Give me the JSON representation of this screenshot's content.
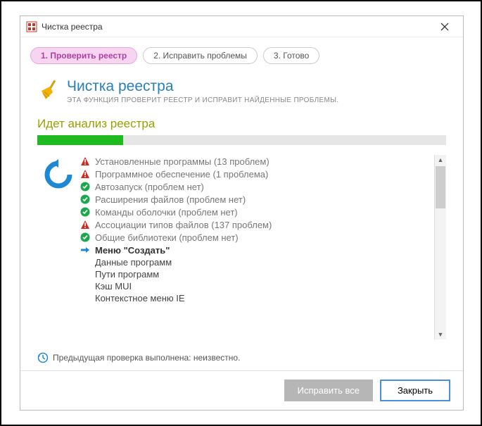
{
  "window": {
    "title": "Чистка реестра"
  },
  "steps": {
    "s1": "1. Проверить реестр",
    "s2": "2. Исправить проблемы",
    "s3": "3. Готово"
  },
  "header": {
    "title": "Чистка реестра",
    "subtitle": "ЭТА ФУНКЦИЯ ПРОВЕРИТ РЕЕСТР И ИСПРАВИТ НАЙДЕННЫЕ ПРОБЛЕМЫ."
  },
  "status": "Идет анализ реестра",
  "items": {
    "installed": "Установленные программы (13 проблем)",
    "software": "Программное обеспечение (1 проблема)",
    "autostart": "Автозапуск (проблем нет)",
    "fileext": "Расширения файлов (проблем нет)",
    "shellcmd": "Команды оболочки (проблем нет)",
    "fileassoc": "Ассоциации типов файлов (137 проблем)",
    "sharedlib": "Общие библиотеки (проблем нет)",
    "createmenu": "Меню \"Создать\"",
    "progdata": "Данные программ",
    "progpaths": "Пути программ",
    "muicache": "Кэш MUI",
    "iecontext": "Контекстное меню IE"
  },
  "prev_check": "Предыдущая проверка выполнена: неизвестно.",
  "buttons": {
    "fix": "Исправить все",
    "close": "Закрыть"
  }
}
